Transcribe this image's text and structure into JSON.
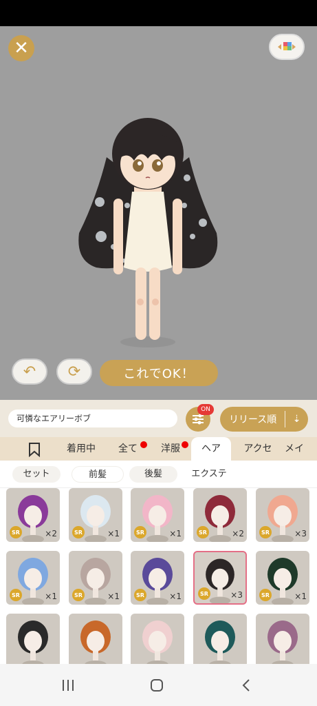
{
  "controls": {
    "close_glyph": "✕",
    "undo_glyph": "↶",
    "redo_glyph": "⟳",
    "ok_label": "これでOK！"
  },
  "toolbar": {
    "outfit_name": "可憐なエアリーボブ",
    "filter_badge": "ON",
    "sort_label": "リリース順",
    "sort_icon_glyph": "⇣"
  },
  "tabs": [
    {
      "label": "着用中",
      "active": false,
      "dot": false
    },
    {
      "label": "全て",
      "active": false,
      "dot": true
    },
    {
      "label": "洋服",
      "active": false,
      "dot": true
    },
    {
      "label": "ヘア",
      "active": true,
      "dot": false
    },
    {
      "label": "アクセ",
      "active": false,
      "dot": false
    },
    {
      "label": "メイ",
      "active": false,
      "dot": false
    }
  ],
  "subtabs": [
    {
      "label": "セット",
      "active": false
    },
    {
      "label": "前髪",
      "active": true
    },
    {
      "label": "後髪",
      "active": false
    },
    {
      "label": "エクステ",
      "active": false
    }
  ],
  "items": [
    {
      "rarity": "SR",
      "count": "×2",
      "hair_color": "#8a3a9a",
      "selected": false
    },
    {
      "rarity": "SR",
      "count": "×1",
      "hair_color": "#dce8f0",
      "selected": false
    },
    {
      "rarity": "SR",
      "count": "×1",
      "hair_color": "#f2b6c8",
      "selected": false
    },
    {
      "rarity": "SR",
      "count": "×2",
      "hair_color": "#8e2a3a",
      "selected": false
    },
    {
      "rarity": "SR",
      "count": "×3",
      "hair_color": "#f0a890",
      "selected": false
    },
    {
      "rarity": "SR",
      "count": "×1",
      "hair_color": "#7fa8e0",
      "selected": false
    },
    {
      "rarity": "SR",
      "count": "×1",
      "hair_color": "#b8a6a0",
      "selected": false
    },
    {
      "rarity": "SR",
      "count": "×1",
      "hair_color": "#5a4a9a",
      "selected": false
    },
    {
      "rarity": "SR",
      "count": "×3",
      "hair_color": "#2c2626",
      "selected": true
    },
    {
      "rarity": "SR",
      "count": "×1",
      "hair_color": "#1e3a2a",
      "selected": false
    },
    {
      "rarity": "",
      "count": "",
      "hair_color": "#2a2a2a",
      "selected": false
    },
    {
      "rarity": "",
      "count": "",
      "hair_color": "#c8682a",
      "selected": false
    },
    {
      "rarity": "",
      "count": "",
      "hair_color": "#f0d0d0",
      "selected": false
    },
    {
      "rarity": "",
      "count": "",
      "hair_color": "#1e5a5a",
      "selected": false
    },
    {
      "rarity": "",
      "count": "",
      "hair_color": "#9a6a8a",
      "selected": false
    }
  ],
  "colors": {
    "accent": "#c9a255",
    "stage_bg": "#9e9e9e",
    "tab_bg": "#ecdfca",
    "selected_border": "#e46f86",
    "badge_red": "#e53935"
  }
}
